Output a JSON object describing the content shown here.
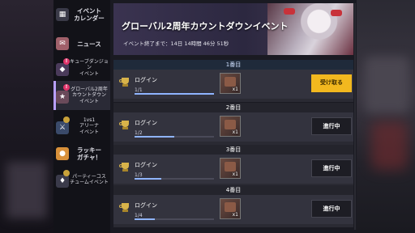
{
  "sidebar": {
    "items": [
      {
        "label": "イベント\nカレンダー",
        "icon": "calendar-icon",
        "active": false
      },
      {
        "label": "ニュース",
        "icon": "news-icon",
        "active": false
      },
      {
        "label": "キューブダンジョン\nイベント",
        "icon": "cube-icon",
        "badge": "!",
        "active": false
      },
      {
        "label": "グローバル2周年\nカウントダウン\nイベント",
        "icon": "countdown-icon",
        "badge": "!",
        "active": true
      },
      {
        "label": "1vs1\nアリーナ\nイベント",
        "icon": "arena-icon",
        "active": false
      },
      {
        "label": "ラッキー\nガチャ！",
        "icon": "gacha-icon",
        "active": false
      },
      {
        "label": "パーティーコス\nチュームイベント",
        "icon": "costume-icon",
        "active": false
      }
    ]
  },
  "banner": {
    "title": "グローバル2周年カウントダウンイベント",
    "subtitle": "イベント終了まで：14日 14時間 46分 51秒"
  },
  "sections": [
    {
      "header": "1番目",
      "mission": "ログイン",
      "progress_text": "1/1",
      "progress": 1.0,
      "reward_qty": "x1",
      "action": "受け取る",
      "state": "claim"
    },
    {
      "header": "2番目",
      "mission": "ログイン",
      "progress_text": "1/2",
      "progress": 0.5,
      "reward_qty": "x1",
      "action": "進行中",
      "state": "progressing"
    },
    {
      "header": "3番目",
      "mission": "ログイン",
      "progress_text": "1/3",
      "progress": 0.333,
      "reward_qty": "x1",
      "action": "進行中",
      "state": "progressing"
    },
    {
      "header": "4番目",
      "mission": "ログイン",
      "progress_text": "1/4",
      "progress": 0.25,
      "reward_qty": "x1",
      "action": "進行中",
      "state": "progressing"
    }
  ],
  "colors": {
    "accent": "#b9a0ff",
    "claim_button": "#f2b81f",
    "progress_fill": "#8fb4ff"
  }
}
